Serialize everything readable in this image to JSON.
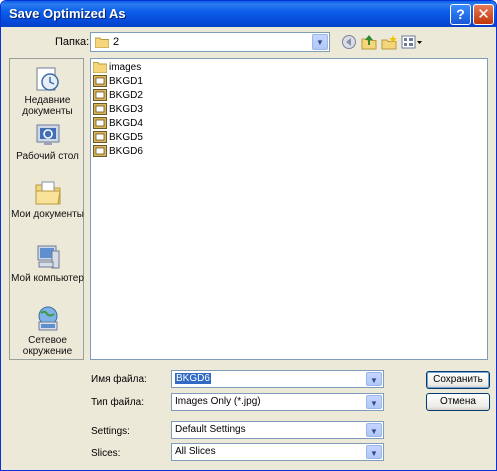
{
  "window": {
    "title": "Save Optimized As",
    "help_label": "?",
    "close_label": "✕"
  },
  "lookin": {
    "label": "Папка:",
    "value": "2",
    "toolbar_icons": [
      "back-icon",
      "up-folder-icon",
      "new-folder-icon",
      "view-menu-icon"
    ]
  },
  "places": [
    {
      "label": "Недавние документы",
      "icon": "recent-documents-icon"
    },
    {
      "label": "Рабочий стол",
      "icon": "desktop-icon"
    },
    {
      "label": "Мои документы",
      "icon": "my-documents-icon"
    },
    {
      "label": "Мой компьютер",
      "icon": "my-computer-icon"
    },
    {
      "label": "Сетевое окружение",
      "icon": "network-places-icon"
    }
  ],
  "files": [
    {
      "name": "images",
      "type": "folder"
    },
    {
      "name": "BKGD1",
      "type": "image"
    },
    {
      "name": "BKGD2",
      "type": "image"
    },
    {
      "name": "BKGD3",
      "type": "image"
    },
    {
      "name": "BKGD4",
      "type": "image"
    },
    {
      "name": "BKGD5",
      "type": "image"
    },
    {
      "name": "BKGD6",
      "type": "image"
    }
  ],
  "form": {
    "filename_label": "Имя файла:",
    "filename_value": "BKGD6",
    "filetype_label": "Тип файла:",
    "filetype_value": "Images Only (*.jpg)",
    "settings_label": "Settings:",
    "settings_value": "Default Settings",
    "slices_label": "Slices:",
    "slices_value": "All Slices"
  },
  "buttons": {
    "save": "Сохранить",
    "cancel": "Отмена"
  },
  "colors": {
    "titlebar": "#0a5fe0",
    "selection": "#316ac5",
    "folder": "#f5d67a"
  }
}
